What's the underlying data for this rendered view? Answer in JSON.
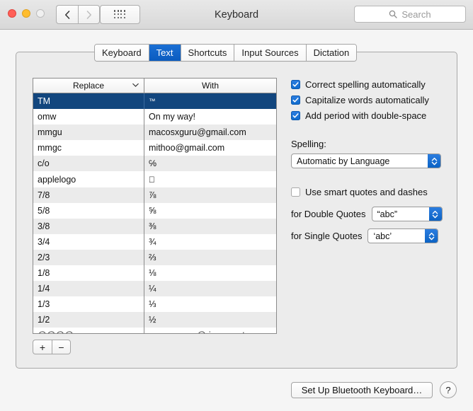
{
  "window": {
    "title": "Keyboard",
    "traffic_lights": [
      "close",
      "minimize",
      "zoom"
    ],
    "nav_back": "‹",
    "nav_forward": "›",
    "grid_button": "show-all-icon"
  },
  "search": {
    "placeholder": "Search",
    "icon": "search-icon"
  },
  "tabs": [
    {
      "label": "Keyboard",
      "active": false
    },
    {
      "label": "Text",
      "active": true
    },
    {
      "label": "Shortcuts",
      "active": false
    },
    {
      "label": "Input Sources",
      "active": false
    },
    {
      "label": "Dictation",
      "active": false
    }
  ],
  "table": {
    "columns": [
      "Replace",
      "With"
    ],
    "sort_indicator": "⌄",
    "rows": [
      {
        "replace": "TM",
        "with": "™",
        "selected": true,
        "small": true
      },
      {
        "replace": "omw",
        "with": "On my way!",
        "selected": false
      },
      {
        "replace": "mmgu",
        "with": "macosxguru@gmail.com",
        "selected": false
      },
      {
        "replace": "mmgc",
        "with": "mithoo@gmail.com",
        "selected": false
      },
      {
        "replace": "c/o",
        "with": "℅",
        "selected": false
      },
      {
        "replace": "applelogo",
        "with": "",
        "selected": false,
        "apple": true
      },
      {
        "replace": "7/8",
        "with": "⅞",
        "selected": false
      },
      {
        "replace": "5/8",
        "with": "⅝",
        "selected": false
      },
      {
        "replace": "3/8",
        "with": "⅜",
        "selected": false
      },
      {
        "replace": "3/4",
        "with": "¾",
        "selected": false
      },
      {
        "replace": "2/3",
        "with": "⅔",
        "selected": false
      },
      {
        "replace": "1/8",
        "with": "⅛",
        "selected": false
      },
      {
        "replace": "1/4",
        "with": "¼",
        "selected": false
      },
      {
        "replace": "1/3",
        "with": "⅓",
        "selected": false
      },
      {
        "replace": "1/2",
        "with": "½",
        "selected": false
      },
      {
        "replace": "@@@@",
        "with": "macosxguru@riseup.net",
        "selected": false
      }
    ]
  },
  "list_controls": {
    "add_label": "+",
    "remove_label": "−"
  },
  "options": {
    "checkboxes": [
      {
        "label": "Correct spelling automatically",
        "checked": true
      },
      {
        "label": "Capitalize words automatically",
        "checked": true
      },
      {
        "label": "Add period with double-space",
        "checked": true
      }
    ],
    "spelling_label": "Spelling:",
    "spelling_value": "Automatic by Language",
    "smart_quotes": {
      "label": "Use smart quotes and dashes",
      "checked": false
    },
    "double_quotes_label": "for Double Quotes",
    "double_quotes_value": "“abc”",
    "single_quotes_label": "for Single Quotes",
    "single_quotes_value": "‘abc’"
  },
  "footer": {
    "bluetooth_button": "Set Up Bluetooth Keyboard…",
    "help_button": "?"
  },
  "colors": {
    "accent_blue": "#0c63c4",
    "selection_blue": "#12467e",
    "window_bg": "#f5f5f5",
    "group_bg": "#ececec",
    "stripe": "#ebebeb"
  }
}
